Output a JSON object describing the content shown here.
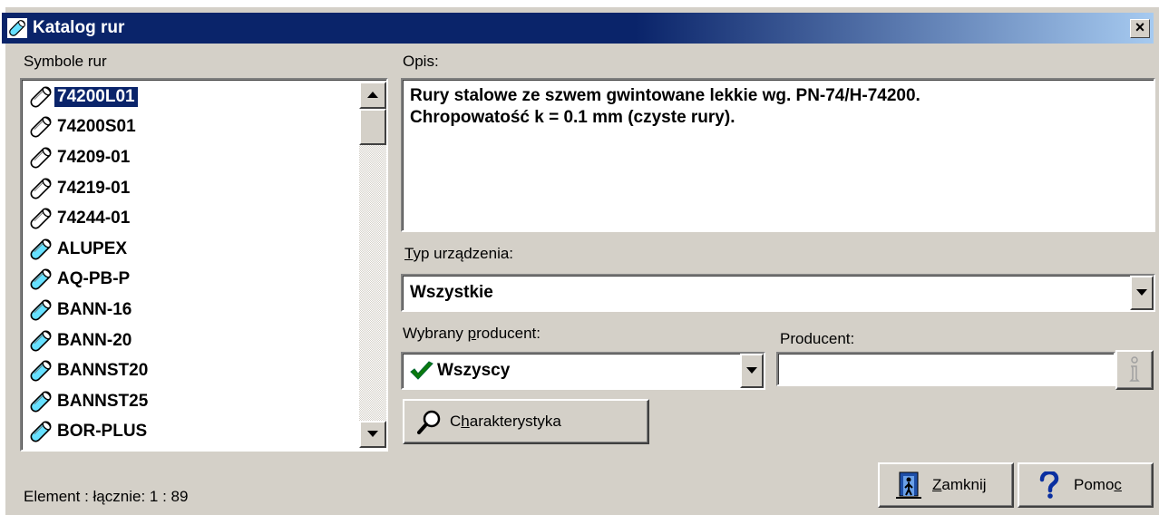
{
  "window": {
    "title": "Katalog rur",
    "close_symbol": "×"
  },
  "left_panel": {
    "label": "Symbole rur",
    "items": [
      {
        "label": "74200L01",
        "icon": "steel-pipe-icon",
        "selected": true
      },
      {
        "label": "74200S01",
        "icon": "steel-pipe-icon"
      },
      {
        "label": "74209-01",
        "icon": "steel-pipe-icon"
      },
      {
        "label": "74219-01",
        "icon": "steel-pipe-icon"
      },
      {
        "label": "74244-01",
        "icon": "steel-pipe-icon"
      },
      {
        "label": "ALUPEX",
        "icon": "plastic-pipe-icon"
      },
      {
        "label": "AQ-PB-P",
        "icon": "plastic-pipe-icon"
      },
      {
        "label": "BANN-16",
        "icon": "plastic-pipe-icon"
      },
      {
        "label": "BANN-20",
        "icon": "plastic-pipe-icon"
      },
      {
        "label": "BANNST20",
        "icon": "plastic-pipe-icon"
      },
      {
        "label": "BANNST25",
        "icon": "plastic-pipe-icon"
      },
      {
        "label": "BOR-PLUS",
        "icon": "plastic-pipe-icon"
      }
    ]
  },
  "description": {
    "label": "Opis:",
    "lines": [
      "Rury stalowe ze szwem gwintowane lekkie wg. PN-74/H-74200.",
      "Chropowatość k = 0.1 mm (czyste rury)."
    ]
  },
  "device_type": {
    "label_first": "T",
    "label_rest": "yp urządzenia:",
    "value": "Wszystkie"
  },
  "selected_producer": {
    "label_pre": "Wybrany ",
    "label_u": "p",
    "label_rest": "roducent:",
    "value": "Wszyscy"
  },
  "producer": {
    "label": "Producent:",
    "value": ""
  },
  "buttons": {
    "characteristics": {
      "pre": "C",
      "u": "h",
      "rest": "arakterystyka"
    },
    "close": {
      "u": "Z",
      "rest": "amknij"
    },
    "help": {
      "pre": "Pomo",
      "u": "c"
    }
  },
  "status": "Element : łącznie: 1 : 89",
  "colors": {
    "titlebar": "#0a246a",
    "face": "#d4d0c8",
    "selection": "#0a246a",
    "pipe_steel": "#ffffff",
    "pipe_plastic": "#66e0ff",
    "check": "#0a7a0a"
  }
}
